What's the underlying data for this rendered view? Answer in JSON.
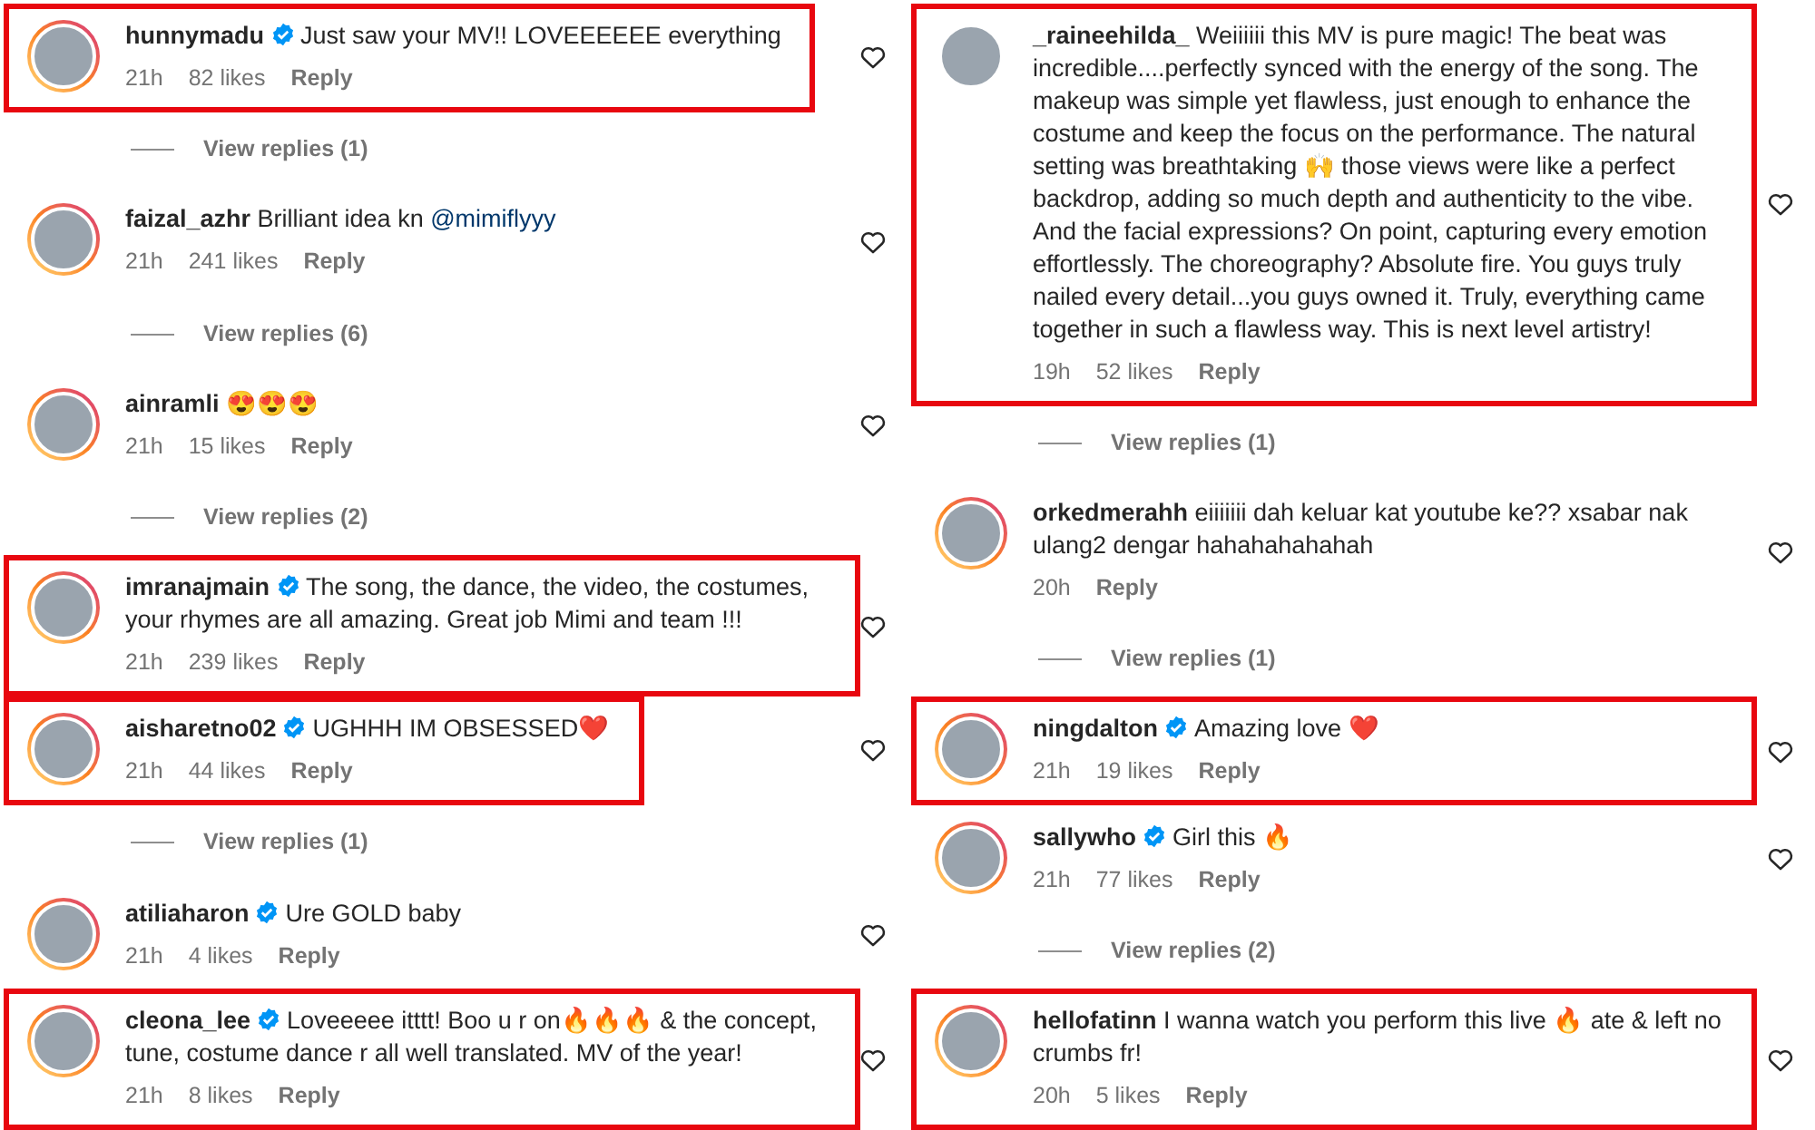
{
  "columns": [
    {
      "items": [
        {
          "kind": "comment",
          "username": "hunnymadu",
          "verified": true,
          "text": "Just saw your MV!! LOVEEEEEE everything",
          "time": "21h",
          "likes": "82 likes",
          "reply": "Reply",
          "highlighted": true,
          "story_ring": true
        },
        {
          "kind": "view_replies",
          "label": "View replies (1)"
        },
        {
          "kind": "comment",
          "username": "faizal_azhr",
          "verified": false,
          "text": "Brilliant idea kn ",
          "mention": "@mimiflyyy",
          "time": "21h",
          "likes": "241 likes",
          "reply": "Reply",
          "highlighted": false,
          "story_ring": true
        },
        {
          "kind": "view_replies",
          "label": "View replies (6)"
        },
        {
          "kind": "comment",
          "username": "ainramli",
          "verified": false,
          "text": "😍😍😍",
          "time": "21h",
          "likes": "15 likes",
          "reply": "Reply",
          "highlighted": false,
          "story_ring": true
        },
        {
          "kind": "view_replies",
          "label": "View replies (2)"
        },
        {
          "kind": "comment",
          "username": "imranajmain",
          "verified": true,
          "text": "The song, the dance, the video, the costumes, your rhymes are all amazing. Great job Mimi and team !!!",
          "time": "21h",
          "likes": "239 likes",
          "reply": "Reply",
          "highlighted": true,
          "story_ring": true
        },
        {
          "kind": "comment",
          "username": "aisharetno02",
          "verified": true,
          "text": "UGHHH IM OBSESSED❤️",
          "time": "21h",
          "likes": "44 likes",
          "reply": "Reply",
          "highlighted": true,
          "story_ring": true
        },
        {
          "kind": "view_replies",
          "label": "View replies (1)"
        },
        {
          "kind": "comment",
          "username": "atiliaharon",
          "verified": true,
          "text": "Ure GOLD baby",
          "time": "21h",
          "likes": "4 likes",
          "reply": "Reply",
          "highlighted": false,
          "story_ring": true
        },
        {
          "kind": "comment",
          "username": "cleona_lee",
          "verified": true,
          "text": "Loveeeee itttt! Boo u r on🔥🔥🔥 & the concept, tune, costume dance r all well translated. MV of the year!",
          "time": "21h",
          "likes": "8 likes",
          "reply": "Reply",
          "highlighted": true,
          "story_ring": true
        }
      ]
    },
    {
      "items": [
        {
          "kind": "comment",
          "username": "_raineehilda_",
          "verified": false,
          "text": "Weiiiiii this MV is pure magic! The beat was incredible....perfectly synced with the energy of the song. The makeup was simple yet flawless, just enough to enhance the costume and keep the focus on the performance. The natural setting was breathtaking 🙌 those views were like a perfect backdrop, adding so much depth and authenticity to the vibe. And the facial expressions? On point, capturing every emotion effortlessly. The choreography? Absolute fire. You guys truly nailed every detail...you guys owned it. Truly, everything came together in such a flawless way. This is next level artistry!",
          "time": "19h",
          "likes": "52 likes",
          "reply": "Reply",
          "highlighted": true,
          "story_ring": false
        },
        {
          "kind": "view_replies",
          "label": "View replies (1)"
        },
        {
          "kind": "comment",
          "username": "orkedmerahh",
          "verified": false,
          "text": "eiiiiiii dah keluar kat youtube ke?? xsabar nak ulang2 dengar hahahahahahah",
          "time": "20h",
          "reply": "Reply",
          "highlighted": false,
          "story_ring": true
        },
        {
          "kind": "view_replies",
          "label": "View replies (1)"
        },
        {
          "kind": "comment",
          "username": "ningdalton",
          "verified": true,
          "text": "Amazing love ❤️",
          "time": "21h",
          "likes": "19 likes",
          "reply": "Reply",
          "highlighted": true,
          "story_ring": true
        },
        {
          "kind": "comment",
          "username": "sallywho",
          "verified": true,
          "text": "Girl this 🔥",
          "time": "21h",
          "likes": "77 likes",
          "reply": "Reply",
          "highlighted": false,
          "story_ring": true
        },
        {
          "kind": "view_replies",
          "label": "View replies (2)"
        },
        {
          "kind": "comment",
          "username": "hellofatinn",
          "verified": false,
          "text": "I wanna watch you perform this live 🔥 ate & left no crumbs fr!",
          "time": "20h",
          "likes": "5 likes",
          "reply": "Reply",
          "highlighted": true,
          "story_ring": true
        }
      ]
    }
  ]
}
